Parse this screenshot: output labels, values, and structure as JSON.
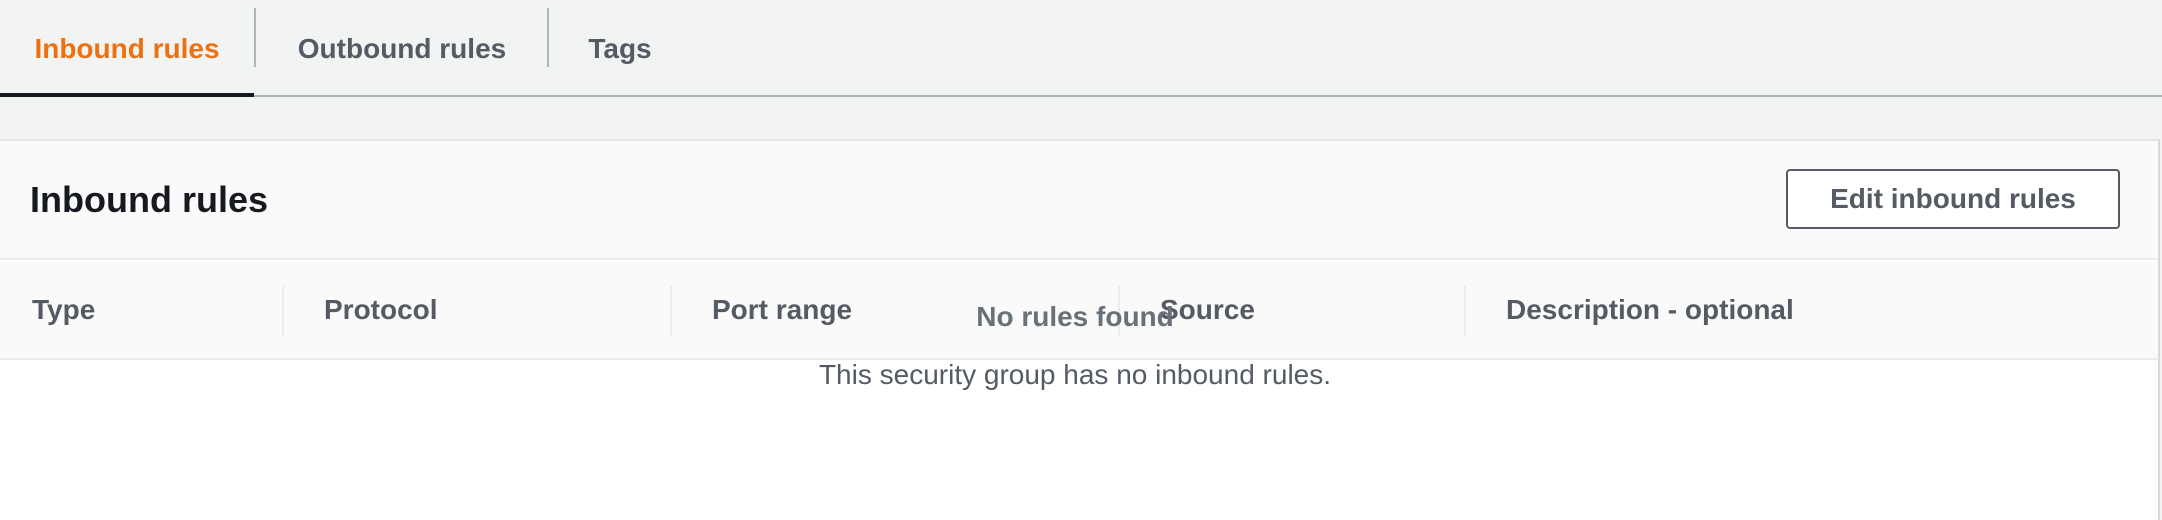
{
  "tabs": [
    {
      "label": "Inbound rules",
      "active": true
    },
    {
      "label": "Outbound rules",
      "active": false
    },
    {
      "label": "Tags",
      "active": false
    }
  ],
  "panel": {
    "title": "Inbound rules",
    "edit_button_label": "Edit inbound rules"
  },
  "table": {
    "columns": [
      "Type",
      "Protocol",
      "Port range",
      "Source",
      "Description - optional"
    ]
  },
  "empty_state": {
    "title": "No rules found",
    "description": "This security group has no inbound rules."
  },
  "colors": {
    "accent": "#ec7211",
    "text": "#545b64",
    "heading": "#16191f",
    "page_background": "#f2f3f3",
    "panel_background": "#ffffff"
  }
}
